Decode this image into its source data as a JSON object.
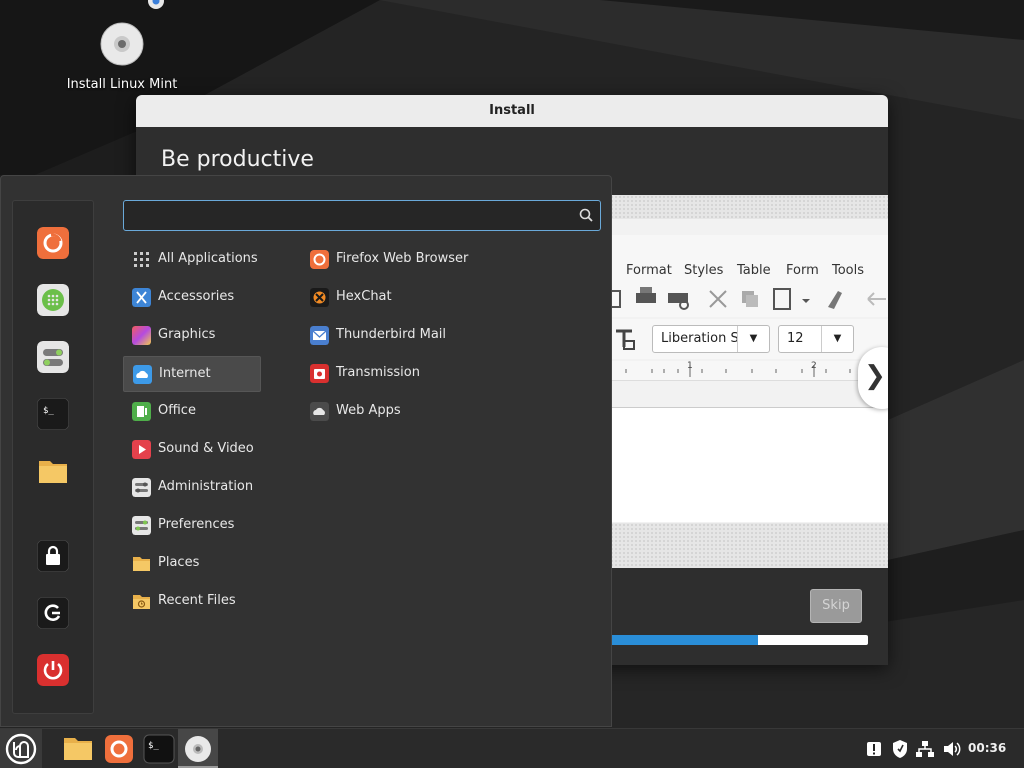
{
  "desktop": {
    "icon_label": "Install Linux Mint"
  },
  "install_window": {
    "title": "Install",
    "heading": "Be productive",
    "slide": {
      "menu_items": [
        "Format",
        "Styles",
        "Table",
        "Form",
        "Tools"
      ],
      "font_name": "Liberation S",
      "font_size": "12",
      "ruler_marks": [
        "1",
        "2"
      ]
    },
    "skip_label": "Skip",
    "progress_fraction": 0.58,
    "colors": {
      "progress": "#2a8ed8"
    }
  },
  "menu": {
    "search_placeholder": "",
    "favorites": [
      "firefox-icon",
      "software-manager-icon",
      "system-settings-icon",
      "terminal-icon",
      "files-folder-icon",
      "lock-screen-icon",
      "logout-icon",
      "shutdown-icon"
    ],
    "categories": [
      {
        "label": "All Applications",
        "icon": "grid-icon"
      },
      {
        "label": "Accessories",
        "icon": "accessories-icon"
      },
      {
        "label": "Graphics",
        "icon": "graphics-icon"
      },
      {
        "label": "Internet",
        "icon": "internet-icon",
        "active": true
      },
      {
        "label": "Office",
        "icon": "office-icon"
      },
      {
        "label": "Sound & Video",
        "icon": "sound-video-icon"
      },
      {
        "label": "Administration",
        "icon": "administration-icon"
      },
      {
        "label": "Preferences",
        "icon": "preferences-icon"
      },
      {
        "label": "Places",
        "icon": "places-folder-icon"
      },
      {
        "label": "Recent Files",
        "icon": "recent-files-icon"
      }
    ],
    "apps": [
      {
        "label": "Firefox Web Browser",
        "icon": "firefox-icon"
      },
      {
        "label": "HexChat",
        "icon": "hexchat-icon"
      },
      {
        "label": "Thunderbird Mail",
        "icon": "thunderbird-icon"
      },
      {
        "label": "Transmission",
        "icon": "transmission-icon"
      },
      {
        "label": "Web Apps",
        "icon": "webapps-icon"
      }
    ]
  },
  "taskbar": {
    "clock": "00:36",
    "launchers": [
      "mint-menu-icon",
      "files-folder-icon",
      "firefox-icon",
      "terminal-icon",
      "install-disc-icon"
    ],
    "tray": [
      "update-manager-icon",
      "shield-icon",
      "network-icon",
      "volume-icon"
    ]
  }
}
